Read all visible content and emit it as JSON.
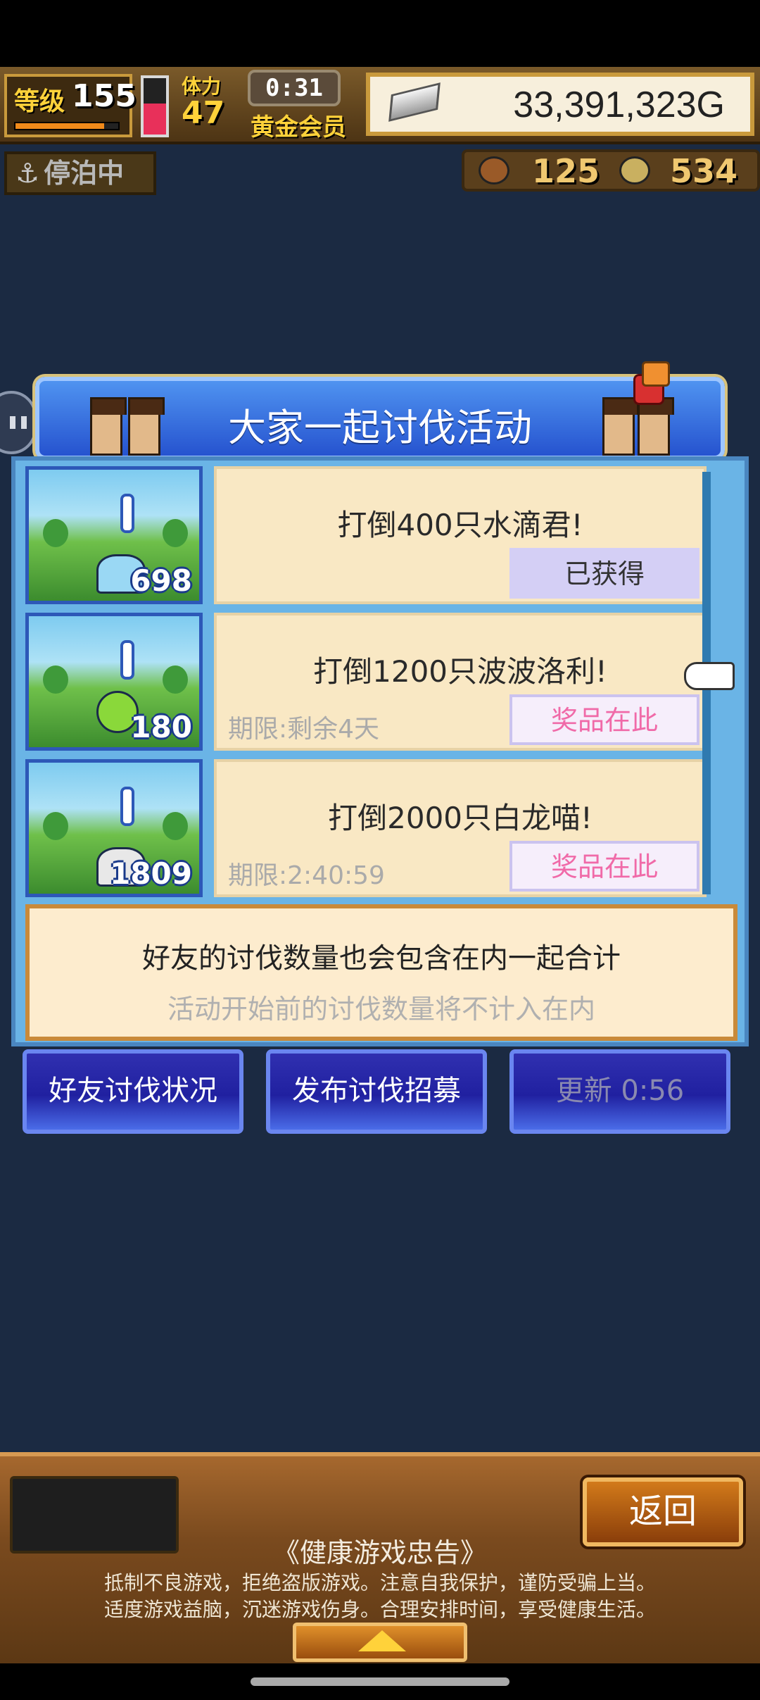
{
  "hud": {
    "level_label": "等级",
    "level_value": "155",
    "stamina_label": "体力",
    "stamina_value": "47",
    "timer": "0:31",
    "membership": "黄金会员",
    "gold": "33,391,323G",
    "dock_status": "停泊中",
    "food_count": "125",
    "coin_count": "534"
  },
  "event": {
    "title": "大家一起讨伐活动",
    "quests": [
      {
        "count": "698",
        "title": "打倒400只水滴君!",
        "deadline": "",
        "button": "已获得"
      },
      {
        "count": "180",
        "title": "打倒1200只波波洛利!",
        "deadline": "期限:剩余4天",
        "button": "奖品在此"
      },
      {
        "count": "1809",
        "title": "打倒2000只白龙喵!",
        "deadline": "期限:2:40:59",
        "button": "奖品在此"
      }
    ],
    "info_main": "好友的讨伐数量也会包含在内一起合计",
    "info_sub": "活动开始前的讨伐数量将不计入在内"
  },
  "buttons": {
    "friends": "好友讨伐状况",
    "recruit": "发布讨伐招募",
    "refresh": "更新 0:56"
  },
  "bottom": {
    "back": "返回",
    "notice_title": "《健康游戏忠告》",
    "notice_line1": "抵制不良游戏，拒绝盗版游戏。注意自我保护，谨防受骗上当。",
    "notice_line2": "适度游戏益脑，沉迷游戏伤身。合理安排时间，享受健康生活。"
  }
}
